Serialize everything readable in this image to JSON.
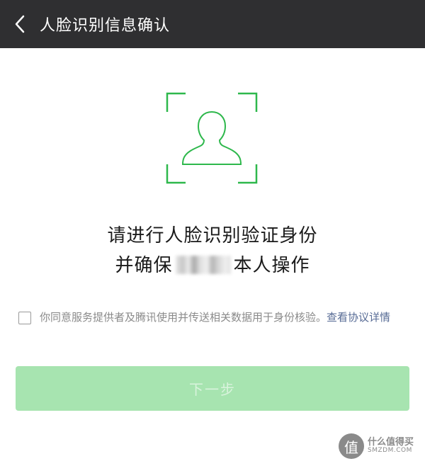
{
  "header": {
    "title": "人脸识别信息确认",
    "back_icon": "chevron-left-icon"
  },
  "face": {
    "icon": "face-scan-frame-icon",
    "accent": "#2eb84c"
  },
  "prompt": {
    "line1": "请进行人脸识别验证身份",
    "line2_prefix": "并确保",
    "line2_suffix": "本人操作"
  },
  "agreement": {
    "checked": false,
    "text": "你同意服务提供者及腾讯使用并传送相关数据用于身份核验。",
    "link": "查看协议详情"
  },
  "next_button": {
    "label": "下一步",
    "enabled": false,
    "color": "#a7e4b0"
  },
  "watermark": {
    "logo_glyph": "值",
    "cn": "什么值得买",
    "en": "SMZDM.COM"
  }
}
